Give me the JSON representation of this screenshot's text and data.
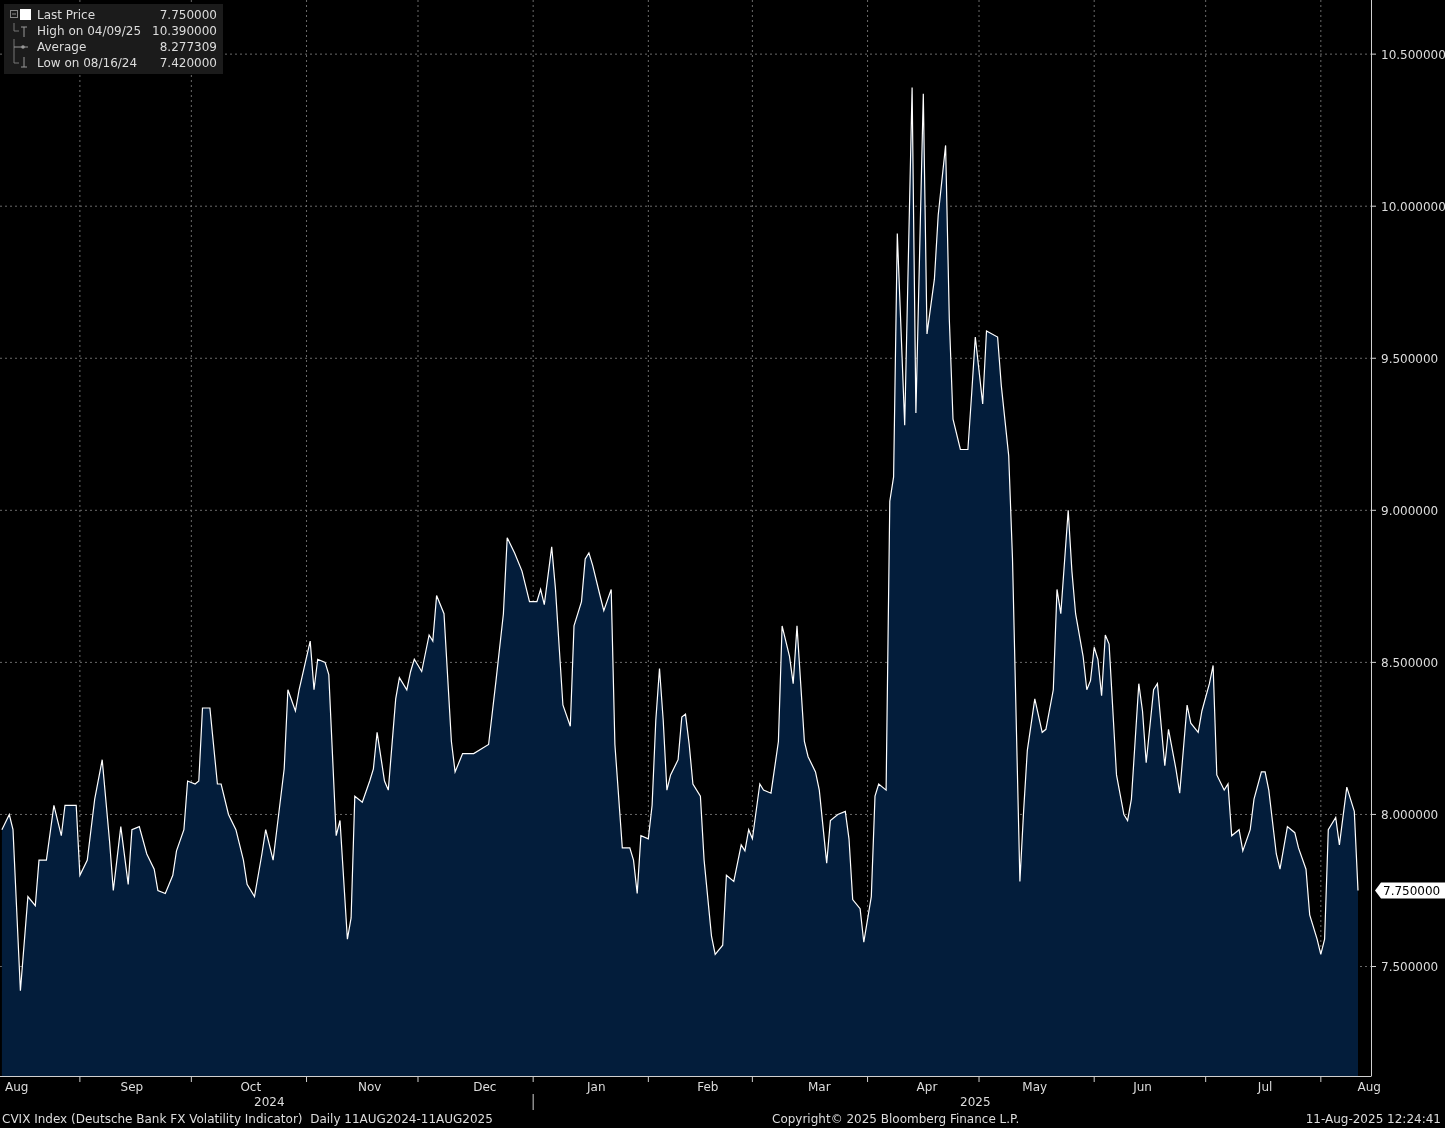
{
  "legend": {
    "items": [
      {
        "kind": "last",
        "label": "Last Price",
        "value": "7.750000"
      },
      {
        "kind": "high",
        "label": "High on 04/09/25",
        "value": "10.390000"
      },
      {
        "kind": "average",
        "label": "Average",
        "value": "8.277309"
      },
      {
        "kind": "low",
        "label": "Low on 08/16/24",
        "value": "7.420000"
      }
    ]
  },
  "chart": {
    "chart_data": {
      "type": "area",
      "grid": true,
      "ylim": [
        7.14,
        10.678
      ],
      "yticks": [
        {
          "value": 7.5,
          "label": "7.500000"
        },
        {
          "value": 8,
          "label": "8.000000"
        },
        {
          "value": 8.5,
          "label": "8.500000"
        },
        {
          "value": 9,
          "label": "9.000000"
        },
        {
          "value": 9.5,
          "label": "9.500000"
        },
        {
          "value": 10,
          "label": "10.000000"
        },
        {
          "value": 10.5,
          "label": "10.500000"
        }
      ],
      "categories": [
        null,
        null,
        null,
        null,
        "Aug",
        null,
        null,
        null,
        null,
        null,
        null,
        null,
        null,
        null,
        null,
        null,
        null,
        null,
        null,
        null,
        null,
        null,
        null,
        null,
        null,
        null,
        null,
        null,
        null,
        null,
        null,
        null,
        null,
        null,
        null,
        "Sep",
        null,
        null,
        null,
        null,
        null,
        null,
        null,
        null,
        null,
        null,
        null,
        null,
        null,
        null,
        null,
        null,
        null,
        null,
        null,
        null,
        null,
        null,
        null,
        null,
        null,
        null,
        null,
        null,
        null,
        null,
        null,
        "Oct",
        null,
        null,
        null,
        null,
        null,
        null,
        null,
        null,
        null,
        null,
        null,
        null,
        null,
        null,
        null,
        null,
        null,
        null,
        null,
        null,
        null,
        null,
        null,
        null,
        null,
        null,
        null,
        null,
        null,
        null,
        null,
        "Nov",
        null,
        null,
        null,
        null,
        null,
        null,
        null,
        null,
        null,
        null,
        null,
        null,
        null,
        null,
        null,
        null,
        null,
        null,
        null,
        null,
        null,
        null,
        null,
        null,
        null,
        null,
        null,
        null,
        null,
        null,
        "Dec",
        null,
        null,
        null,
        null,
        null,
        null,
        null,
        null,
        null,
        null,
        null,
        null,
        null,
        null,
        null,
        null,
        null,
        null,
        null,
        null,
        null,
        null,
        null,
        null,
        null,
        null,
        null,
        null,
        null,
        "Jan",
        null,
        null,
        null,
        null,
        null,
        null,
        null,
        null,
        null,
        null,
        null,
        null,
        null,
        null,
        null,
        null,
        null,
        null,
        null,
        null,
        null,
        null,
        null,
        null,
        null,
        null,
        null,
        null,
        null,
        "Feb",
        null,
        null,
        null,
        null,
        null,
        null,
        null,
        null,
        null,
        null,
        null,
        null,
        null,
        null,
        null,
        null,
        null,
        null,
        null,
        null,
        null,
        null,
        null,
        null,
        null,
        null,
        null,
        null,
        null,
        "Mar",
        null,
        null,
        null,
        null,
        null,
        null,
        null,
        null,
        null,
        null,
        null,
        null,
        null,
        null,
        null,
        null,
        null,
        null,
        null,
        null,
        null,
        null,
        null,
        null,
        null,
        null,
        null,
        null,
        "Apr",
        null,
        null,
        null,
        null,
        null,
        null,
        null,
        null,
        null,
        null,
        null,
        null,
        null,
        null,
        null,
        null,
        null,
        null,
        null,
        null,
        null,
        null,
        null,
        null,
        null,
        null,
        null,
        null,
        "May",
        null,
        null,
        null,
        null,
        null,
        null,
        null,
        null,
        null,
        null,
        null,
        null,
        null,
        null,
        null,
        null,
        null,
        null,
        null,
        null,
        null,
        null,
        null,
        null,
        null,
        null,
        null,
        null,
        "Jun",
        null,
        null,
        null,
        null,
        null,
        null,
        null,
        null,
        null,
        null,
        null,
        null,
        null,
        null,
        null,
        null,
        null,
        null,
        null,
        null,
        null,
        null,
        null,
        null,
        null,
        null,
        null,
        null,
        null,
        null,
        null,
        null,
        "Jul",
        null,
        null,
        null,
        null,
        null,
        null,
        null,
        null,
        null,
        null,
        null,
        null,
        null,
        null,
        null,
        null,
        null,
        null,
        null,
        null,
        null,
        null,
        null,
        null,
        null,
        null,
        null,
        "Aug"
      ],
      "series": [
        {
          "color": "#ffffff",
          "values": [
            7.95,
            null,
            8.0,
            7.95,
            null,
            7.42,
            null,
            7.73,
            null,
            7.7,
            7.85,
            null,
            7.85,
            null,
            8.03,
            null,
            7.93,
            8.03,
            null,
            null,
            8.03,
            7.8,
            null,
            7.85,
            null,
            8.05,
            null,
            8.18,
            null,
            7.91,
            7.75,
            null,
            7.96,
            null,
            7.77,
            7.95,
            null,
            7.96,
            null,
            7.87,
            null,
            7.82,
            7.75,
            null,
            7.74,
            null,
            7.8,
            7.88,
            null,
            7.95,
            8.11,
            null,
            8.1,
            8.11,
            8.35,
            null,
            8.35,
            null,
            8.1,
            8.1,
            null,
            8.0,
            null,
            7.95,
            null,
            7.85,
            7.77,
            null,
            7.73,
            null,
            7.87,
            7.95,
            null,
            7.85,
            7.95,
            null,
            8.15,
            8.41,
            null,
            8.34,
            8.41,
            null,
            null,
            8.57,
            8.41,
            8.51,
            null,
            8.5,
            8.46,
            null,
            7.93,
            7.98,
            null,
            7.59,
            7.66,
            8.06,
            null,
            8.04,
            null,
            8.11,
            8.15,
            8.27,
            null,
            8.11,
            8.08,
            null,
            8.38,
            8.45,
            null,
            8.41,
            8.47,
            8.51,
            null,
            8.47,
            null,
            8.59,
            8.57,
            8.72,
            null,
            8.66,
            null,
            8.24,
            8.14,
            null,
            8.2,
            null,
            null,
            8.2,
            null,
            null,
            null,
            8.23,
            null,
            8.44,
            null,
            8.66,
            8.91,
            null,
            8.86,
            null,
            8.8,
            null,
            8.7,
            null,
            8.7,
            8.74,
            8.69,
            null,
            8.88,
            8.74,
            null,
            8.36,
            null,
            8.29,
            8.62,
            null,
            8.7,
            8.84,
            8.86,
            8.82,
            null,
            8.72,
            8.67,
            null,
            8.74,
            8.23,
            null,
            7.89,
            null,
            7.89,
            7.85,
            7.74,
            7.93,
            null,
            7.92,
            8.03,
            8.31,
            8.48,
            8.31,
            8.08,
            8.13,
            null,
            8.18,
            8.32,
            8.33,
            8.23,
            8.1,
            null,
            8.06,
            7.85,
            null,
            7.6,
            7.54,
            null,
            7.57,
            7.8,
            null,
            7.78,
            null,
            7.9,
            7.88,
            7.95,
            7.92,
            null,
            8.1,
            8.08,
            null,
            8.07,
            null,
            8.24,
            8.62,
            null,
            8.52,
            8.43,
            8.62,
            null,
            8.24,
            8.19,
            null,
            8.14,
            8.08,
            null,
            7.84,
            7.98,
            null,
            8.0,
            null,
            8.01,
            7.92,
            7.72,
            null,
            7.69,
            7.58,
            null,
            7.73,
            8.06,
            8.1,
            null,
            8.08,
            9.03,
            9.11,
            9.91,
            null,
            9.28,
            null,
            10.39,
            9.32,
            null,
            10.37,
            9.58,
            null,
            9.76,
            9.97,
            null,
            10.2,
            9.63,
            9.3,
            null,
            9.2,
            null,
            9.2,
            9.38,
            9.57,
            null,
            9.35,
            9.59,
            null,
            null,
            9.57,
            9.41,
            null,
            9.18,
            8.84,
            null,
            7.78,
            8.01,
            8.21,
            null,
            8.38,
            null,
            8.27,
            8.28,
            null,
            8.41,
            8.74,
            8.66,
            null,
            9.0,
            8.8,
            8.66,
            null,
            8.52,
            8.41,
            8.44,
            8.55,
            8.51,
            8.39,
            8.59,
            8.56,
            null,
            8.13,
            null,
            8.0,
            7.98,
            8.05,
            null,
            8.43,
            8.34,
            8.17,
            null,
            8.41,
            8.43,
            null,
            8.16,
            8.28,
            null,
            8.15,
            8.07,
            null,
            8.36,
            8.3,
            null,
            8.27,
            8.34,
            null,
            8.43,
            8.49,
            8.13,
            null,
            8.08,
            8.1,
            7.93,
            null,
            7.95,
            7.88,
            null,
            7.95,
            8.05,
            null,
            8.14,
            8.14,
            8.08,
            null,
            7.87,
            7.82,
            null,
            7.96,
            null,
            7.94,
            7.89,
            null,
            7.82,
            7.67,
            null,
            7.59,
            7.54,
            7.59,
            7.95,
            null,
            7.99,
            7.9,
            null,
            8.09,
            null,
            8.01,
            7.75,
            null,
            null,
            null
          ]
        }
      ]
    },
    "year_labels": [
      "2024",
      "2025"
    ],
    "last_price_tag": {
      "label": "7.750000"
    }
  },
  "footer": {
    "description": "CVIX Index (Deutsche Bank FX Volatility Indicator)  Daily 11AUG2024-11AUG2025",
    "copyright": "Copyright© 2025 Bloomberg Finance L.P.",
    "timestamp": "11-Aug-2025 12:24:41"
  }
}
